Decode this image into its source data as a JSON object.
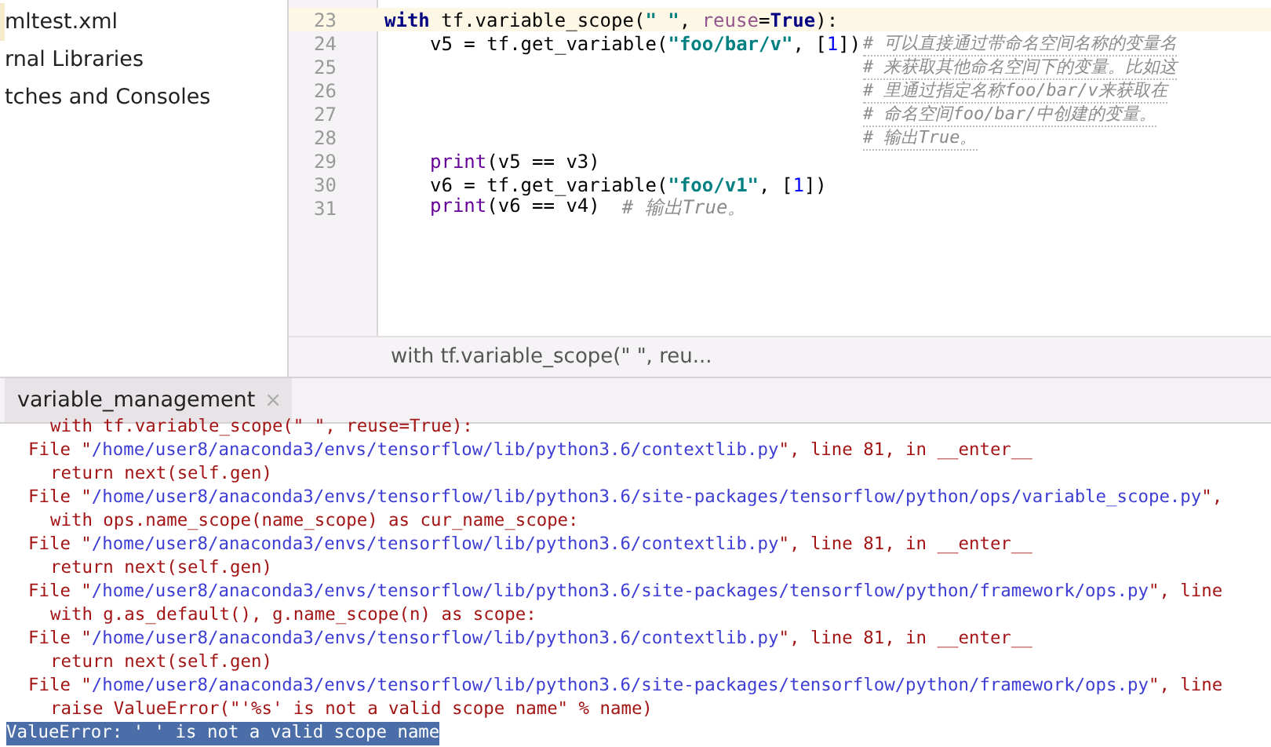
{
  "project_tree": {
    "items": [
      {
        "label": "mltest.xml",
        "selected": true
      },
      {
        "label": "rnal Libraries",
        "selected": false
      },
      {
        "label": "tches and Consoles",
        "selected": false
      }
    ]
  },
  "editor": {
    "lines": [
      {
        "number": "23",
        "current": true,
        "segments": [
          {
            "text": "with",
            "kind": "keyword"
          },
          {
            "text": " tf.variable_scope(",
            "kind": "plain"
          },
          {
            "text": "\" \"",
            "kind": "string"
          },
          {
            "text": ", ",
            "kind": "plain"
          },
          {
            "text": "reuse",
            "kind": "param"
          },
          {
            "text": "=",
            "kind": "plain"
          },
          {
            "text": "True",
            "kind": "keyword"
          },
          {
            "text": "):",
            "kind": "plain"
          }
        ],
        "children": [
          {
            "number": "24",
            "current": false,
            "segments": [
              {
                "text": "v5 = tf.get_variable(",
                "kind": "plain"
              },
              {
                "text": "\"foo/bar/v\"",
                "kind": "string"
              },
              {
                "text": ", [",
                "kind": "plain"
              },
              {
                "text": "1",
                "kind": "number"
              },
              {
                "text": "])",
                "kind": "plain"
              }
            ],
            "comment": "# 可以直接通过带命名空间名称的变量名"
          },
          {
            "number": "25",
            "current": false,
            "comment": "# 来获取其他命名空间下的变量。比如这"
          },
          {
            "number": "26",
            "current": false,
            "comment": "# 里通过指定名称foo/bar/v来获取在"
          },
          {
            "number": "27",
            "current": false,
            "comment": "# 命名空间foo/bar/中创建的变量。"
          },
          {
            "number": "28",
            "current": false,
            "comment": "# 输出True。"
          },
          {
            "number": "29",
            "current": false,
            "segments": [
              {
                "text": "print",
                "kind": "builtin"
              },
              {
                "text": "(v5 == v3)",
                "kind": "plain"
              }
            ]
          },
          {
            "number": "30",
            "current": false,
            "segments": [
              {
                "text": "v6 = tf.get_variable(",
                "kind": "plain"
              },
              {
                "text": "\"foo/v1\"",
                "kind": "string"
              },
              {
                "text": ", [",
                "kind": "plain"
              },
              {
                "text": "1",
                "kind": "number"
              },
              {
                "text": "])",
                "kind": "plain"
              }
            ]
          },
          {
            "number": "31",
            "current": false,
            "segments": [
              {
                "text": "print",
                "kind": "builtin"
              },
              {
                "text": "(v6 == v4)",
                "kind": "plain"
              },
              {
                "text": "# 输出True。",
                "kind": "comment"
              }
            ]
          }
        ]
      }
    ],
    "breadcrumb": "with tf.variable_scope(\" \", reu..."
  },
  "run_panel": {
    "tabs": [
      {
        "label": "variable_management",
        "close": "×",
        "selected": true
      }
    ],
    "lines": [
      {
        "kind": "code",
        "segments": [
          {
            "text": "with tf.variable_scope(\" \", reuse=True):",
            "kind": "plain"
          }
        ]
      },
      {
        "kind": "file",
        "segments": [
          {
            "text": "File \"",
            "kind": "plain"
          },
          {
            "text": "/home/user8/anaconda3/envs/tensorflow/lib/python3.6/contextlib.py",
            "kind": "link"
          },
          {
            "text": "\", line 81, in __enter__",
            "kind": "plain"
          }
        ]
      },
      {
        "kind": "code",
        "segments": [
          {
            "text": "return next(self.gen)",
            "kind": "plain"
          }
        ]
      },
      {
        "kind": "file",
        "segments": [
          {
            "text": "File \"",
            "kind": "plain"
          },
          {
            "text": "/home/user8/anaconda3/envs/tensorflow/lib/python3.6/site-packages/tensorflow/python/ops/variable_scope.py",
            "kind": "link"
          },
          {
            "text": "\",",
            "kind": "plain"
          }
        ]
      },
      {
        "kind": "code",
        "segments": [
          {
            "text": "with ops.name_scope(name_scope) as cur_name_scope:",
            "kind": "plain"
          }
        ]
      },
      {
        "kind": "file",
        "segments": [
          {
            "text": "File \"",
            "kind": "plain"
          },
          {
            "text": "/home/user8/anaconda3/envs/tensorflow/lib/python3.6/contextlib.py",
            "kind": "link"
          },
          {
            "text": "\", line 81, in __enter__",
            "kind": "plain"
          }
        ]
      },
      {
        "kind": "code",
        "segments": [
          {
            "text": "return next(self.gen)",
            "kind": "plain"
          }
        ]
      },
      {
        "kind": "file",
        "segments": [
          {
            "text": "File \"",
            "kind": "plain"
          },
          {
            "text": "/home/user8/anaconda3/envs/tensorflow/lib/python3.6/site-packages/tensorflow/python/framework/ops.py",
            "kind": "link"
          },
          {
            "text": "\", line",
            "kind": "plain"
          }
        ]
      },
      {
        "kind": "code",
        "segments": [
          {
            "text": "with g.as_default(), g.name_scope(n) as scope:",
            "kind": "plain"
          }
        ]
      },
      {
        "kind": "file",
        "segments": [
          {
            "text": "File \"",
            "kind": "plain"
          },
          {
            "text": "/home/user8/anaconda3/envs/tensorflow/lib/python3.6/contextlib.py",
            "kind": "link"
          },
          {
            "text": "\", line 81, in __enter__",
            "kind": "plain"
          }
        ]
      },
      {
        "kind": "code",
        "segments": [
          {
            "text": "return next(self.gen)",
            "kind": "plain"
          }
        ]
      },
      {
        "kind": "file",
        "segments": [
          {
            "text": "File \"",
            "kind": "plain"
          },
          {
            "text": "/home/user8/anaconda3/envs/tensorflow/lib/python3.6/site-packages/tensorflow/python/framework/ops.py",
            "kind": "link"
          },
          {
            "text": "\", line",
            "kind": "plain"
          }
        ]
      },
      {
        "kind": "code",
        "segments": [
          {
            "text": "raise ValueError(\"'%s' is not a valid scope name\" % name)",
            "kind": "plain"
          }
        ]
      },
      {
        "kind": "error",
        "selected": true,
        "segments": [
          {
            "text": "ValueError: ' ' is not a valid scope name",
            "kind": "plain"
          }
        ]
      }
    ]
  }
}
